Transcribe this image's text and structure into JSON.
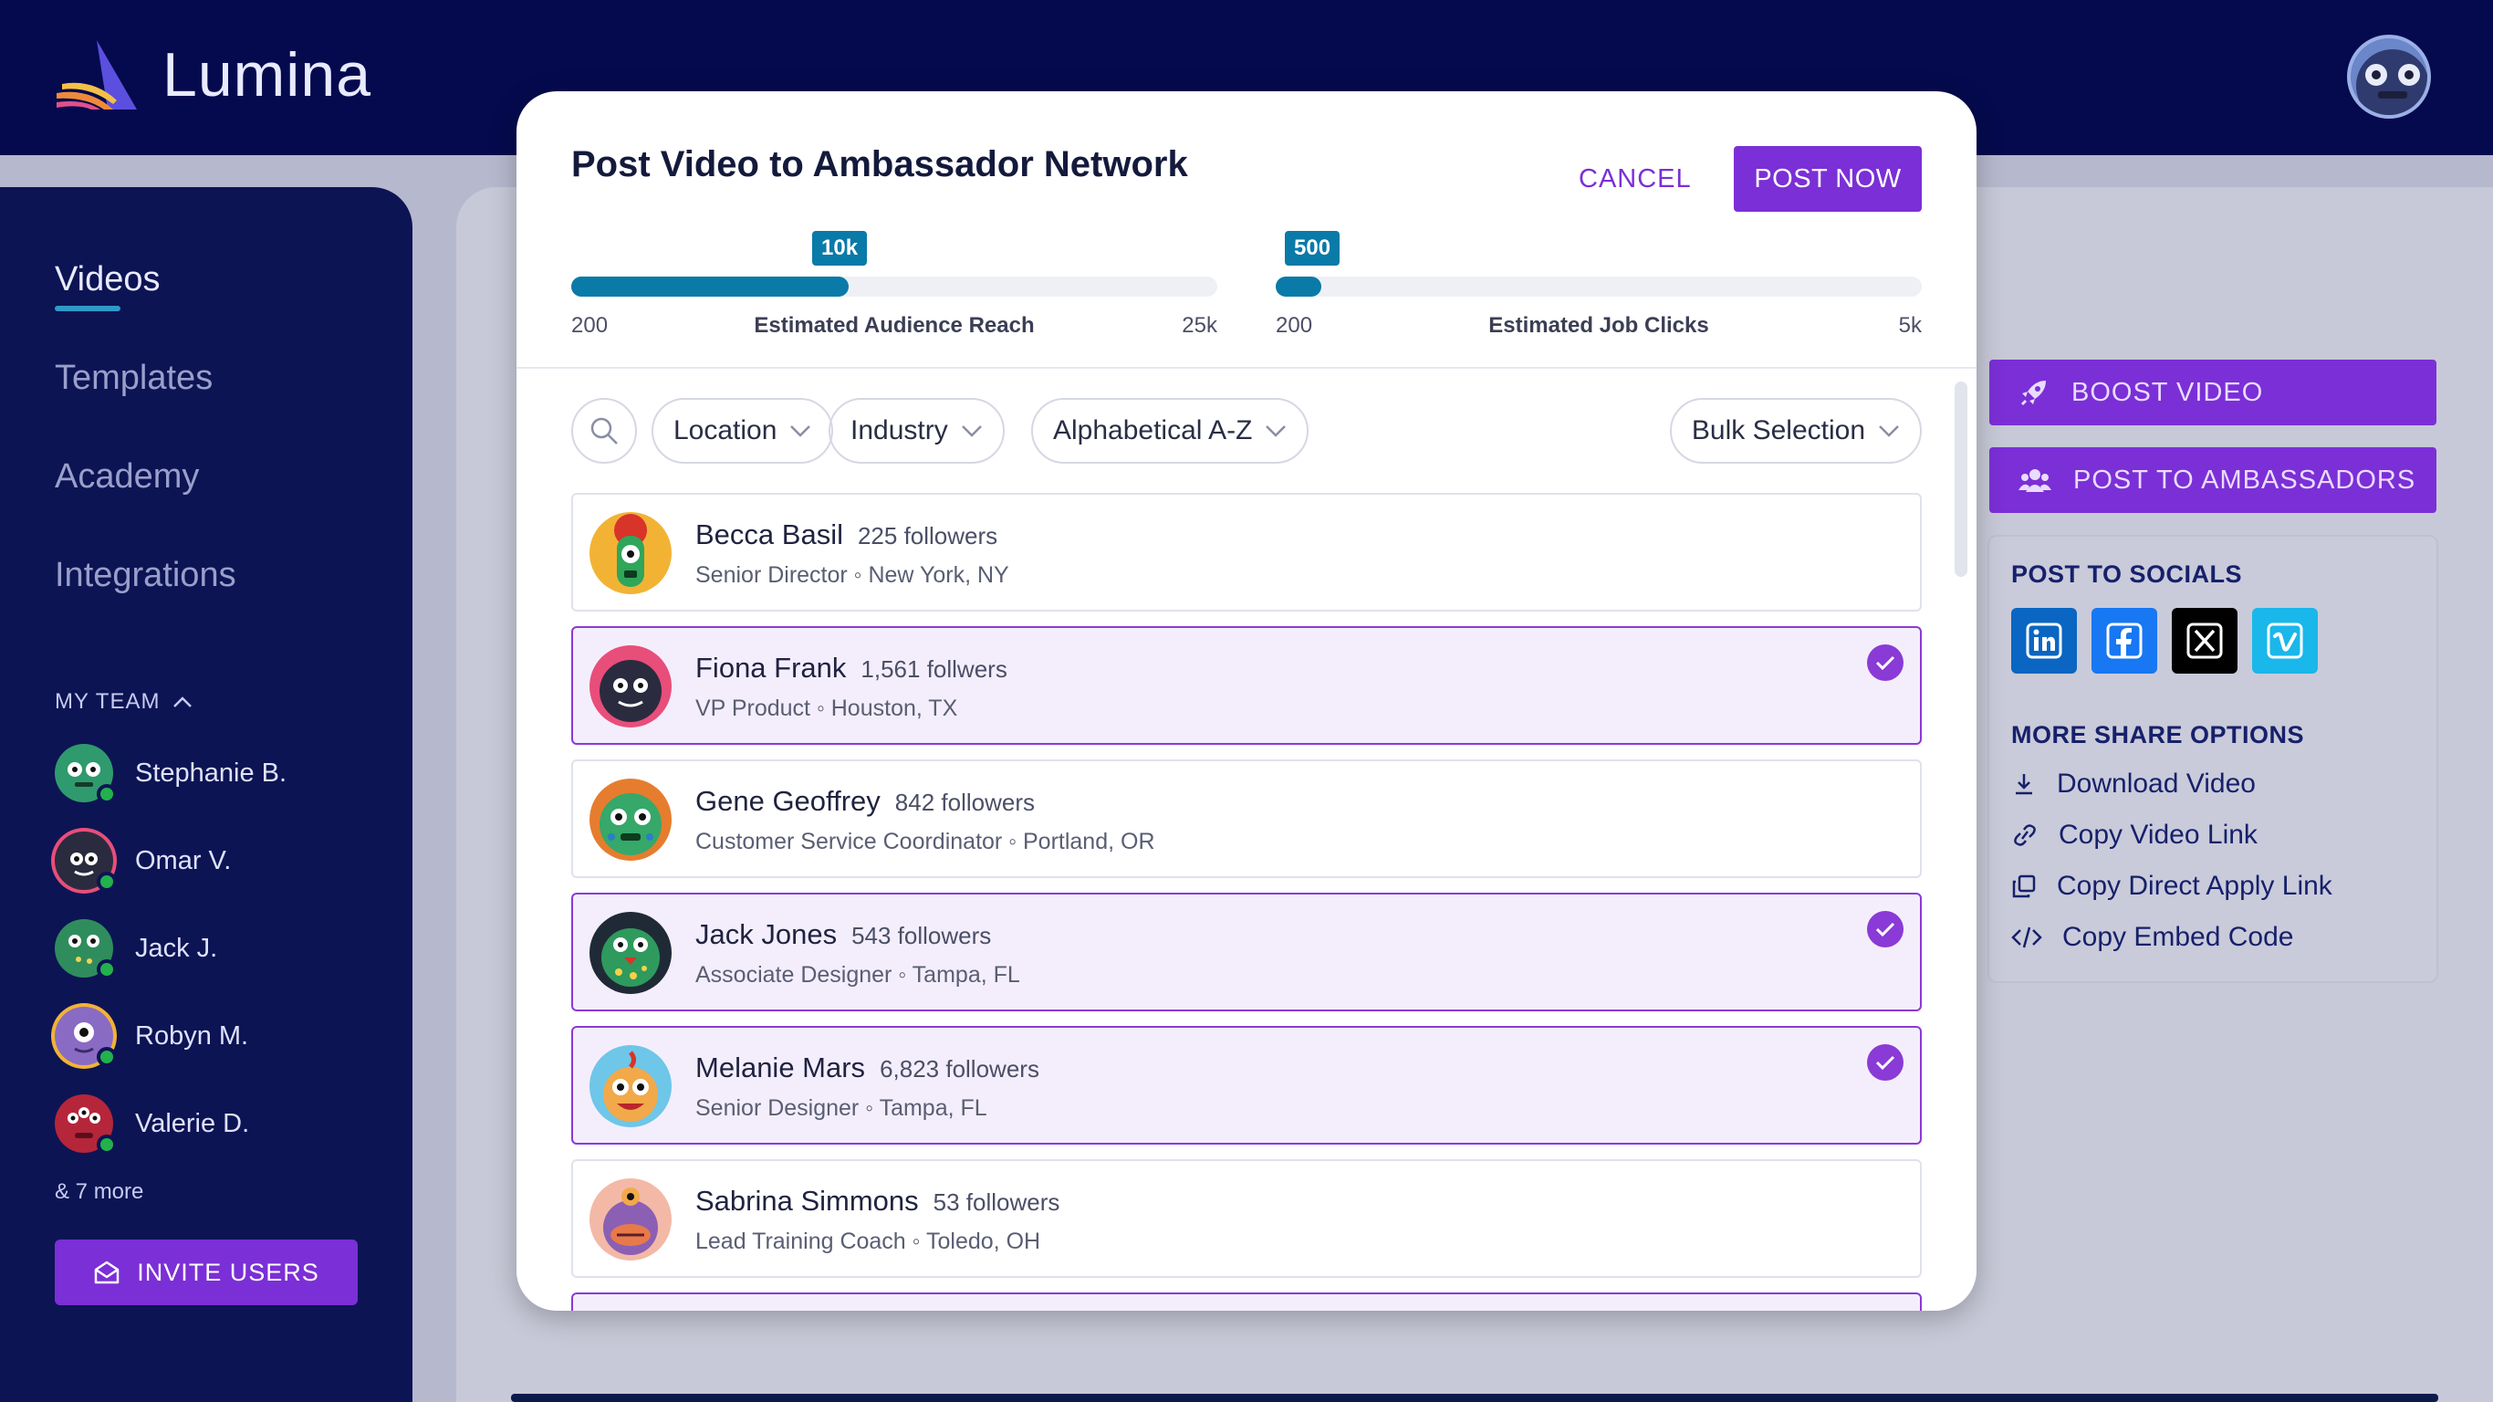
{
  "app": {
    "name": "Lumina"
  },
  "sidebar": {
    "nav": [
      {
        "label": "Videos",
        "active": true
      },
      {
        "label": "Templates",
        "active": false
      },
      {
        "label": "Academy",
        "active": false
      },
      {
        "label": "Integrations",
        "active": false
      }
    ],
    "team": {
      "title": "MY TEAM",
      "members": [
        {
          "name": "Stephanie B.",
          "avatar_color": "#2f9a6e"
        },
        {
          "name": "Omar V.",
          "avatar_color": "#2b2b3f"
        },
        {
          "name": "Jack J.",
          "avatar_color": "#2f8d5d"
        },
        {
          "name": "Robyn M.",
          "avatar_color": "#8a6bc4"
        },
        {
          "name": "Valerie D.",
          "avatar_color": "#b5263a"
        }
      ],
      "more": "& 7 more"
    },
    "invite_label": "INVITE USERS"
  },
  "modal": {
    "title": "Post Video to Ambassador Network",
    "cancel_label": "CANCEL",
    "post_label": "POST NOW",
    "meters": [
      {
        "label": "Estimated Audience Reach",
        "value_label": "10k",
        "min": "200",
        "max": "25k",
        "fill_fraction": 0.43
      },
      {
        "label": "Estimated Job Clicks",
        "value_label": "500",
        "min": "200",
        "max": "5k",
        "fill_fraction": 0.07
      }
    ],
    "filters": {
      "location": "Location",
      "industry": "Industry",
      "sort": "Alphabetical A-Z",
      "bulk": "Bulk Selection"
    },
    "ambassadors": [
      {
        "name": "Becca Basil",
        "followers": "225 followers",
        "subtitle": "Senior Director ◦ New York, NY",
        "selected": false,
        "avatar_bg": "#f2b335",
        "monster": "#2fa65a"
      },
      {
        "name": "Fiona Frank",
        "followers": "1,561 follwers",
        "subtitle": "VP Product ◦ Houston, TX",
        "selected": true,
        "avatar_bg": "#e84e7a",
        "monster": "#2b2b3f"
      },
      {
        "name": "Gene Geoffrey",
        "followers": "842 followers",
        "subtitle": "Customer Service Coordinator ◦ Portland, OR",
        "selected": false,
        "avatar_bg": "#e67d2e",
        "monster": "#35a86a"
      },
      {
        "name": "Jack Jones",
        "followers": "543 followers",
        "subtitle": "Associate Designer ◦ Tampa, FL",
        "selected": true,
        "avatar_bg": "#1f2a36",
        "monster": "#2f9a5d"
      },
      {
        "name": "Melanie Mars",
        "followers": "6,823 followers",
        "subtitle": "Senior Designer ◦ Tampa, FL",
        "selected": true,
        "avatar_bg": "#6ec6e8",
        "monster": "#f2a94a"
      },
      {
        "name": "Sabrina Simmons",
        "followers": "53 followers",
        "subtitle": "Lead Training Coach ◦ Toledo, OH",
        "selected": false,
        "avatar_bg": "#f3b9a6",
        "monster": "#8b5fb3"
      }
    ]
  },
  "actions": {
    "boost_label": "BOOST VIDEO",
    "ambassadors_label": "POST TO AMBASSADORS",
    "socials_title": "POST TO SOCIALS",
    "socials": [
      {
        "icon": "linkedin-icon",
        "color": "#0a66c2"
      },
      {
        "icon": "facebook-icon",
        "color": "#1877f2"
      },
      {
        "icon": "x-icon",
        "color": "#000000"
      },
      {
        "icon": "vimeo-icon",
        "color": "#1ab7ea"
      }
    ],
    "more_title": "MORE SHARE OPTIONS",
    "options": [
      {
        "label": "Download Video",
        "icon": "download-icon"
      },
      {
        "label": "Copy Video Link",
        "icon": "link-icon"
      },
      {
        "label": "Copy Direct Apply Link",
        "icon": "copy-icon"
      },
      {
        "label": "Copy Embed Code",
        "icon": "code-icon"
      }
    ]
  },
  "colors": {
    "accent": "#7b2fd6",
    "meter": "#0a7aa8",
    "navy": "#050a4e"
  }
}
